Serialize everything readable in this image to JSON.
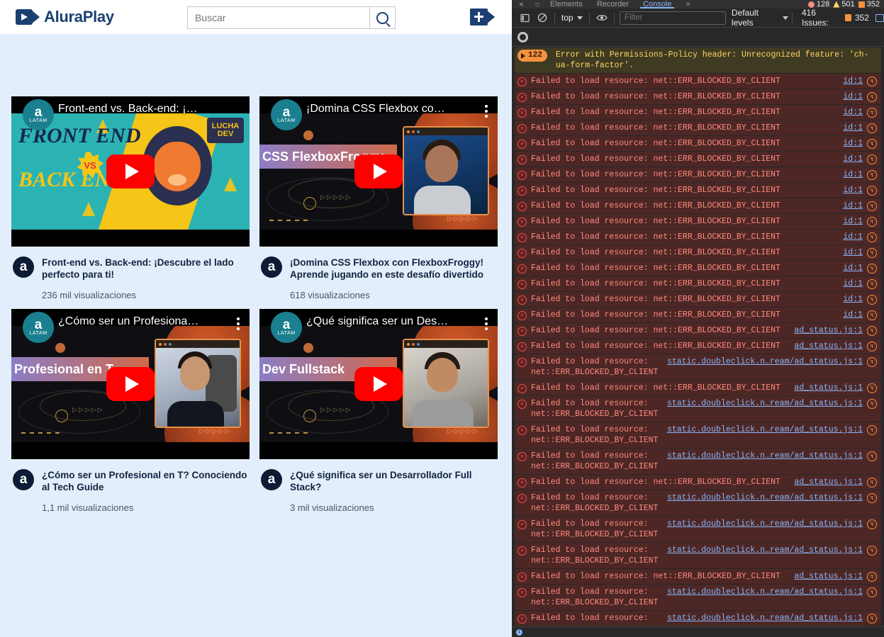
{
  "site": {
    "logo_text": "AluraPlay",
    "search_placeholder": "Buscar",
    "search_value": "",
    "search_icon": "search-icon",
    "new_video_icon": "add-video-icon"
  },
  "videos": [
    {
      "overlay_title": "Front-end vs. Back-end: ¡…",
      "title": "Front-end vs. Back-end: ¡Descubre el lado perfecto para ti!",
      "views": "236 mil visualizaciones",
      "avatar": "a",
      "channel_badge": "LATAM",
      "art_line1": "FRONT END",
      "art_line2": "BACK END",
      "art_vs": "VS",
      "art_logo": "LUCHA DEV"
    },
    {
      "overlay_title": "¡Domina CSS Flexbox co…",
      "title": "¡Domina CSS Flexbox con FlexboxFroggy! Aprende jugando en este desafío divertido",
      "views": "618 visualizaciones",
      "avatar": "a",
      "channel_badge": "LATAM",
      "ribbon": "CSS FlexboxFroggy"
    },
    {
      "overlay_title": "¿Cómo ser un Profesiona…",
      "title": "¿Cómo ser un Profesional en T? Conociendo al Tech Guide",
      "views": "1,1 mil visualizaciones",
      "avatar": "a",
      "channel_badge": "LATAM",
      "ribbon": "Profesional en T"
    },
    {
      "overlay_title": "¿Qué significa ser un Des…",
      "title": "¿Qué significa ser un Desarrollador Full Stack?",
      "views": "3 mil visualizaciones",
      "avatar": "a",
      "channel_badge": "LATAM",
      "ribbon": "Dev Fullstack"
    }
  ],
  "devtools": {
    "tabs": [
      {
        "label": "Elements",
        "active": false
      },
      {
        "label": "Recorder",
        "active": false
      },
      {
        "label": "Console",
        "active": true
      },
      {
        "label": "»",
        "active": false
      }
    ],
    "counts": {
      "errors": "128",
      "warnings": "501",
      "issues": "352"
    },
    "toolbar": {
      "sidebar_icon": "sidebar-toggle-icon",
      "clear_icon": "clear-console-icon",
      "context": "top",
      "eye_icon": "live-expression-icon",
      "filter_placeholder": "Filter",
      "filter_value": "",
      "levels": "Default levels",
      "issues_label": "416 Issues:",
      "issues_count": "352",
      "settings_icon": "settings-gear-icon"
    },
    "messages": [
      {
        "type": "warn",
        "badge": "122",
        "text": "Error with Permissions-Policy header: Unrecognized feature: 'ch-ua-form-factor'.",
        "link": ""
      },
      {
        "type": "err",
        "text": "Failed to load resource: net::ERR_BLOCKED_BY_CLIENT",
        "link": "id:1"
      },
      {
        "type": "err",
        "text": "Failed to load resource: net::ERR_BLOCKED_BY_CLIENT",
        "link": "id:1"
      },
      {
        "type": "err",
        "text": "Failed to load resource: net::ERR_BLOCKED_BY_CLIENT",
        "link": "id:1"
      },
      {
        "type": "err",
        "text": "Failed to load resource: net::ERR_BLOCKED_BY_CLIENT",
        "link": "id:1"
      },
      {
        "type": "err",
        "text": "Failed to load resource: net::ERR_BLOCKED_BY_CLIENT",
        "link": "id:1"
      },
      {
        "type": "err",
        "text": "Failed to load resource: net::ERR_BLOCKED_BY_CLIENT",
        "link": "id:1"
      },
      {
        "type": "err",
        "text": "Failed to load resource: net::ERR_BLOCKED_BY_CLIENT",
        "link": "id:1"
      },
      {
        "type": "err",
        "text": "Failed to load resource: net::ERR_BLOCKED_BY_CLIENT",
        "link": "id:1"
      },
      {
        "type": "err",
        "text": "Failed to load resource: net::ERR_BLOCKED_BY_CLIENT",
        "link": "id:1"
      },
      {
        "type": "err",
        "text": "Failed to load resource: net::ERR_BLOCKED_BY_CLIENT",
        "link": "id:1"
      },
      {
        "type": "err",
        "text": "Failed to load resource: net::ERR_BLOCKED_BY_CLIENT",
        "link": "id:1"
      },
      {
        "type": "err",
        "text": "Failed to load resource: net::ERR_BLOCKED_BY_CLIENT",
        "link": "id:1"
      },
      {
        "type": "err",
        "text": "Failed to load resource: net::ERR_BLOCKED_BY_CLIENT",
        "link": "id:1"
      },
      {
        "type": "err",
        "text": "Failed to load resource: net::ERR_BLOCKED_BY_CLIENT",
        "link": "id:1"
      },
      {
        "type": "err",
        "text": "Failed to load resource: net::ERR_BLOCKED_BY_CLIENT",
        "link": "id:1"
      },
      {
        "type": "err",
        "text": "Failed to load resource: net::ERR_BLOCKED_BY_CLIENT",
        "link": "id:1"
      },
      {
        "type": "err",
        "text": "Failed to load resource: net::ERR_BLOCKED_BY_CLIENT",
        "link": "ad_status.js:1"
      },
      {
        "type": "err",
        "text": "Failed to load resource: net::ERR_BLOCKED_BY_CLIENT",
        "link": "ad_status.js:1"
      },
      {
        "type": "err",
        "wrap": true,
        "text": "Failed to load resource: net::ERR_BLOCKED_BY_CLIENT",
        "link": "static.doubleclick.n…ream/ad_status.js:1"
      },
      {
        "type": "err",
        "text": "Failed to load resource: net::ERR_BLOCKED_BY_CLIENT",
        "link": "ad_status.js:1"
      },
      {
        "type": "err",
        "wrap": true,
        "text": "Failed to load resource: net::ERR_BLOCKED_BY_CLIENT",
        "link": "static.doubleclick.n…ream/ad_status.js:1"
      },
      {
        "type": "err",
        "wrap": true,
        "text": "Failed to load resource: net::ERR_BLOCKED_BY_CLIENT",
        "link": "static.doubleclick.n…ream/ad_status.js:1"
      },
      {
        "type": "err",
        "wrap": true,
        "text": "Failed to load resource: net::ERR_BLOCKED_BY_CLIENT",
        "link": "static.doubleclick.n…ream/ad_status.js:1"
      },
      {
        "type": "err",
        "text": "Failed to load resource: net::ERR_BLOCKED_BY_CLIENT",
        "link": "ad_status.js:1"
      },
      {
        "type": "err",
        "wrap": true,
        "text": "Failed to load resource: net::ERR_BLOCKED_BY_CLIENT",
        "link": "static.doubleclick.n…ream/ad_status.js:1"
      },
      {
        "type": "err",
        "wrap": true,
        "text": "Failed to load resource: net::ERR_BLOCKED_BY_CLIENT",
        "link": "static.doubleclick.n…ream/ad_status.js:1"
      },
      {
        "type": "err",
        "wrap": true,
        "text": "Failed to load resource: net::ERR_BLOCKED_BY_CLIENT",
        "link": "static.doubleclick.n…ream/ad_status.js:1"
      },
      {
        "type": "err",
        "text": "Failed to load resource: net::ERR_BLOCKED_BY_CLIENT",
        "link": "ad_status.js:1"
      },
      {
        "type": "err",
        "wrap": true,
        "text": "Failed to load resource: net::ERR_BLOCKED_BY_CLIENT",
        "link": "static.doubleclick.n…ream/ad_status.js:1"
      },
      {
        "type": "err",
        "text": "Failed to load resource:",
        "link": "static.doubleclick.n…ream/ad_status.js:1"
      }
    ]
  }
}
